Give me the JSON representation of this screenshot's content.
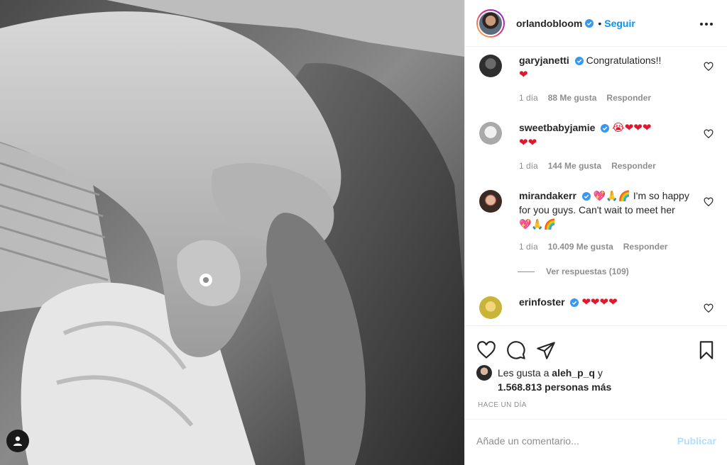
{
  "post": {
    "author": "orlandobloom",
    "follow_label": "Seguir",
    "separator": "•"
  },
  "comments": [
    {
      "user": "garyjanetti",
      "text_before": "Congratulations!!",
      "hearts_line1": "",
      "hearts_line2": "❤",
      "time": "1 día",
      "likes": "88 Me gusta",
      "reply": "Responder",
      "avatar_color": "#3a3a3a"
    },
    {
      "user": "sweetbabyjamie",
      "text_before": "😭❤❤❤",
      "hearts_line2": "❤❤",
      "time": "1 día",
      "likes": "144 Me gusta",
      "reply": "Responder",
      "avatar_color": "#bfbfbf"
    },
    {
      "user": "mirandakerr",
      "emoji_start": "💖🙏🌈",
      "text": "I'm so happy for you guys. Can't wait to meet her",
      "emoji_end": "💖🙏🌈",
      "time": "1 día",
      "likes": "10.409 Me gusta",
      "reply": "Responder",
      "view_replies": "Ver respuestas (109)",
      "avatar_color": "#8a5a48"
    },
    {
      "user": "erinfoster",
      "text_before": "❤❤❤❤",
      "avatar_color": "#d9c84a"
    }
  ],
  "likes": {
    "prefix": "Les gusta a",
    "user": "aleh_p_q",
    "connector": "y",
    "count": "1.568.813 personas más"
  },
  "time_ago": "HACE UN DÍA",
  "add_comment": {
    "placeholder": "Añade un comentario...",
    "publish_label": "Publicar"
  },
  "colors": {
    "accent": "#0095f6",
    "heart": "#e0182d",
    "muted": "#8e8e8e",
    "publish_disabled": "#b2dffc"
  },
  "icons": [
    "user-tag-icon",
    "verified-badge-icon",
    "more-options-icon",
    "heart-outline-icon",
    "comment-icon",
    "share-icon",
    "bookmark-icon"
  ]
}
